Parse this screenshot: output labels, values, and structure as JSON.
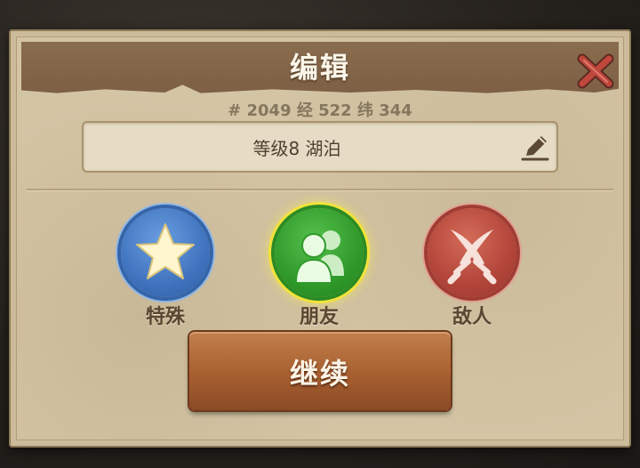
{
  "dialog": {
    "title": "编辑",
    "coords": "# 2049 经 522  纬 344",
    "name_value": "等级8 湖泊"
  },
  "choices": [
    {
      "label": "特殊",
      "icon": "star-icon",
      "color": "#3f73be"
    },
    {
      "label": "朋友",
      "icon": "friends-icon",
      "color": "#2f9a2a",
      "selected": true
    },
    {
      "label": "敌人",
      "icon": "crossed-swords-icon",
      "color": "#b2453a"
    }
  ],
  "continue_button": {
    "label": "继续"
  },
  "colors": {
    "title_band": "#7c5f44",
    "parchment": "#d3c4a4",
    "close_icon": "#c0473c",
    "highlight_glow": "#f2e23c"
  }
}
